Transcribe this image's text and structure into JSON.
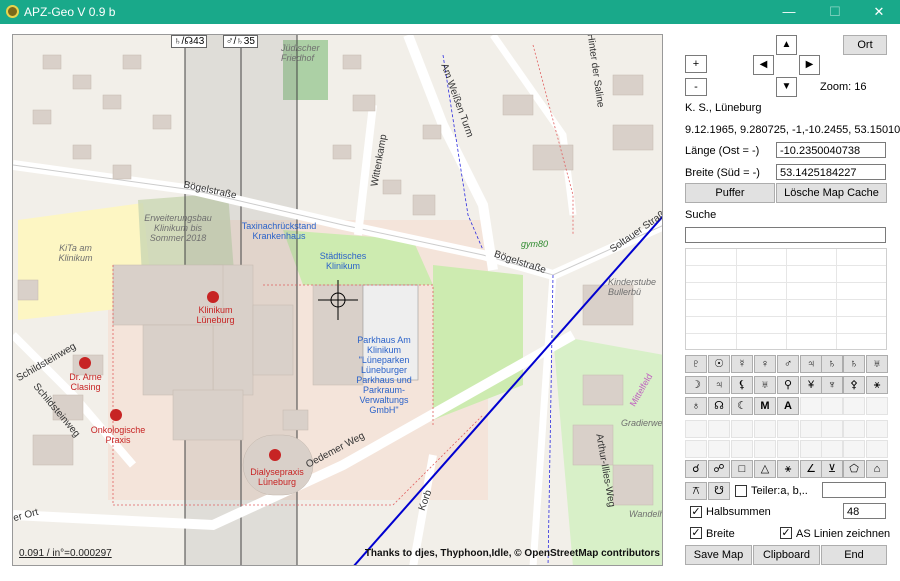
{
  "window": {
    "title": "APZ-Geo V 0.9 b",
    "minimize": "—",
    "maximize": "☐",
    "close": "✕"
  },
  "map": {
    "scale_text": "0.091 / in°=0.000297",
    "attribution": "Thanks to djes, Thyphoon,Idle,  © OpenStreetMap contributors",
    "strip_labels": [
      "♄/☊43",
      "♂/♄35"
    ],
    "labels": {
      "juedischer_friedhof": "Jüdischer Friedhof",
      "boegelstrasse_1": "Bögelstraße",
      "boegelstrasse_2": "Bögelstraße",
      "am_weissen_turm": "Am Weißen Turm",
      "hinter_der_saline": "Hinter der Saline",
      "wittenkamp": "Wittenkamp",
      "soltauer_strasse": "Soltauer Straße",
      "taxi": "Taxinachrückstand Krankenhaus",
      "staedtisches_klinikum": "Städtisches Klinikum",
      "erweiterungsbau": "Erweiterungsbau Klinikum bis Sommer 2018",
      "kita": "KiTa am Klinikum",
      "klinikum": "Klinikum Lüneburg",
      "parkhaus": "Parkhaus Am Klinikum \"Lüneparken Lüneburger Parkhaus und Parkraum-Verwaltungs GmbH\"",
      "dr_arne_clasing": "Dr. Arne Clasing",
      "onkologische": "Onkologische Praxis",
      "dialyse": "Dialysepraxis Lüneburg",
      "oedemer_weg": "Oedemer Weg",
      "schildsteinweg_1": "Schildsteinweg",
      "schildsteinweg_2": "Schildsteinweg",
      "korb": "Korb",
      "arthur_illies": "Arthur-Illies-Weg",
      "kinderstube": "Kinderstube Bullerbü",
      "gradierweg": "Gradierweg",
      "wandelhalle": "Wandelh",
      "gym80": "gym80",
      "ort": "er Ort",
      "mittelfeld": "Mittelfeld"
    }
  },
  "panel": {
    "ort_button": "Ort",
    "plus": "+",
    "minus": "-",
    "up": "▲",
    "down": "▼",
    "left": "◀",
    "right": "▶",
    "zoom": "Zoom: 16",
    "person": "K. S., Lüneburg",
    "data_line": "9.12.1965, 9.280725, -1,-10.2455, 53.15010",
    "laenge_label": "Länge  (Ost = -)",
    "laenge_value": "-10.2350040738",
    "breite_label": "Breite (Süd = -)",
    "breite_value": "53.1425184227",
    "puffer": "Puffer",
    "loesche_cache": "Lösche Map Cache",
    "suche": "Suche",
    "suche_value": "",
    "symbols_row1": [
      "♇",
      "☉",
      "☿",
      "♀",
      "♂",
      "♃",
      "♄",
      "♅"
    ],
    "symbols_row2": [
      "☽",
      "♃",
      "⚸",
      "♅",
      "⚲",
      "¥",
      "⚴",
      "⚹"
    ],
    "symbols_row3": [
      "♁",
      "☊",
      "☾",
      "M",
      "A"
    ],
    "aspects_row": [
      "☌",
      "☍",
      "□",
      "△",
      "⚹",
      "∠",
      "⊻",
      "⬠",
      "⌂"
    ],
    "extra_row": [
      "⚻",
      "☋"
    ],
    "teiler_label": "Teiler:a, b,..",
    "teiler_value": "",
    "halbsummen_label": "Halbsummen",
    "halbsummen_value": "48",
    "breite_check_label": "Breite",
    "as_linien_label": "AS Linien zeichnen",
    "save_map": "Save Map",
    "clipboard": "Clipboard",
    "end": "End",
    "halbsummen_checked": "✓",
    "breite_checked": "✓",
    "as_linien_checked": "✓"
  }
}
